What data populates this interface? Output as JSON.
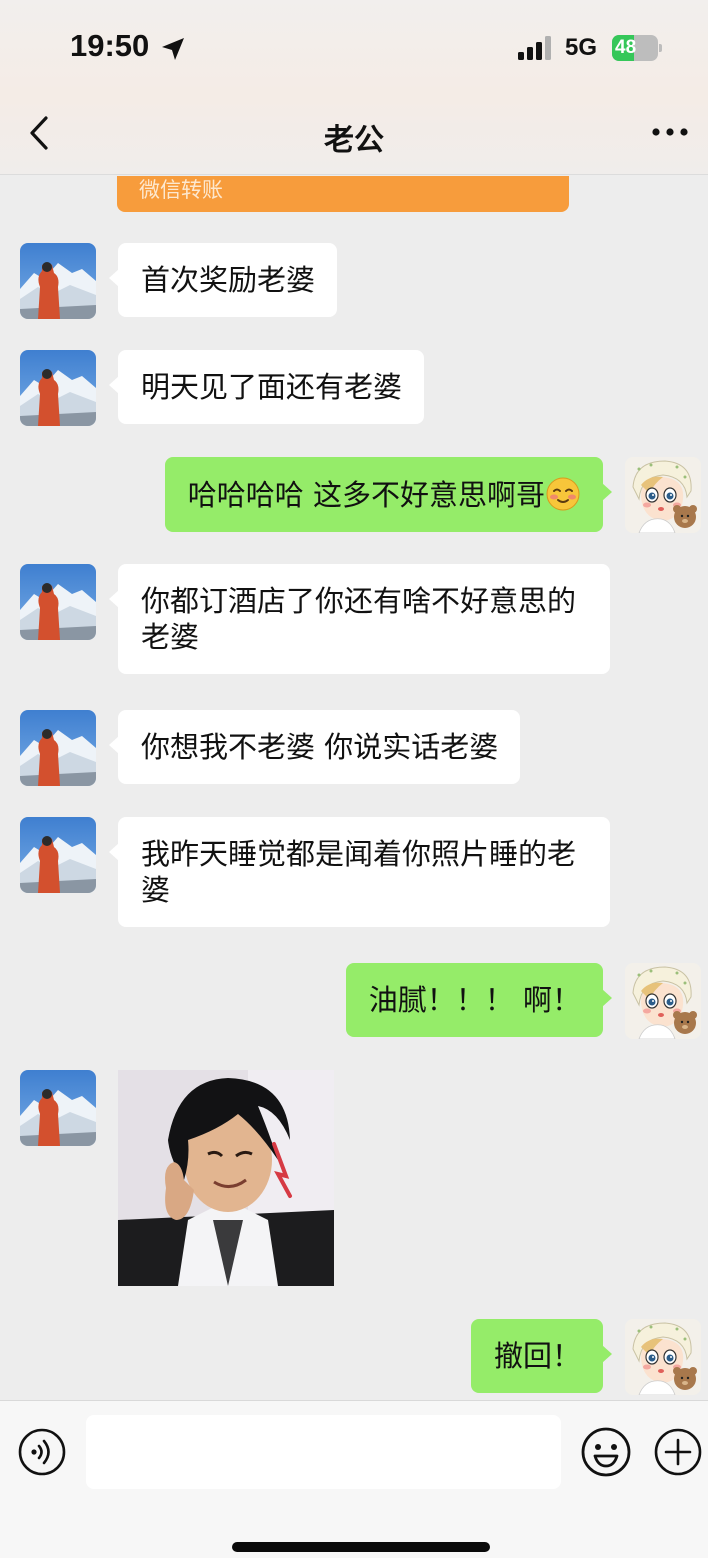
{
  "status_bar": {
    "time": "19:50",
    "network": "5G",
    "battery_level": "48",
    "battery_fraction": 0.48
  },
  "header": {
    "title": "老公",
    "back_icon": "chevron-left-icon",
    "more_icon": "more-dots-icon"
  },
  "transfer": {
    "label": "微信转账",
    "color": "#f79c3c"
  },
  "messages": [
    {
      "side": "left",
      "text": "首次奖励老婆"
    },
    {
      "side": "left",
      "text": "明天见了面还有老婆"
    },
    {
      "side": "right",
      "text": "哈哈哈哈 这多不好意思啊哥",
      "emoji": "blush-emoji"
    },
    {
      "side": "left",
      "text": "你都订酒店了你还有啥不好意思的老婆"
    },
    {
      "side": "left",
      "text": "你想我不老婆 你说实话老婆"
    },
    {
      "side": "left",
      "text": "我昨天睡觉都是闻着你照片睡的老婆"
    },
    {
      "side": "right",
      "text": "油腻！！！ 啊！"
    },
    {
      "side": "left",
      "type": "sticker",
      "sticker": "photo-sticker"
    },
    {
      "side": "right",
      "text": "撤回！"
    }
  ],
  "input_bar": {
    "placeholder": "",
    "voice_icon": "voice-icon",
    "emoji_icon": "emoji-icon",
    "plus_icon": "plus-icon"
  },
  "colors": {
    "sent_bubble": "#95ec69",
    "received_bubble": "#ffffff",
    "chat_background": "#ededed"
  }
}
